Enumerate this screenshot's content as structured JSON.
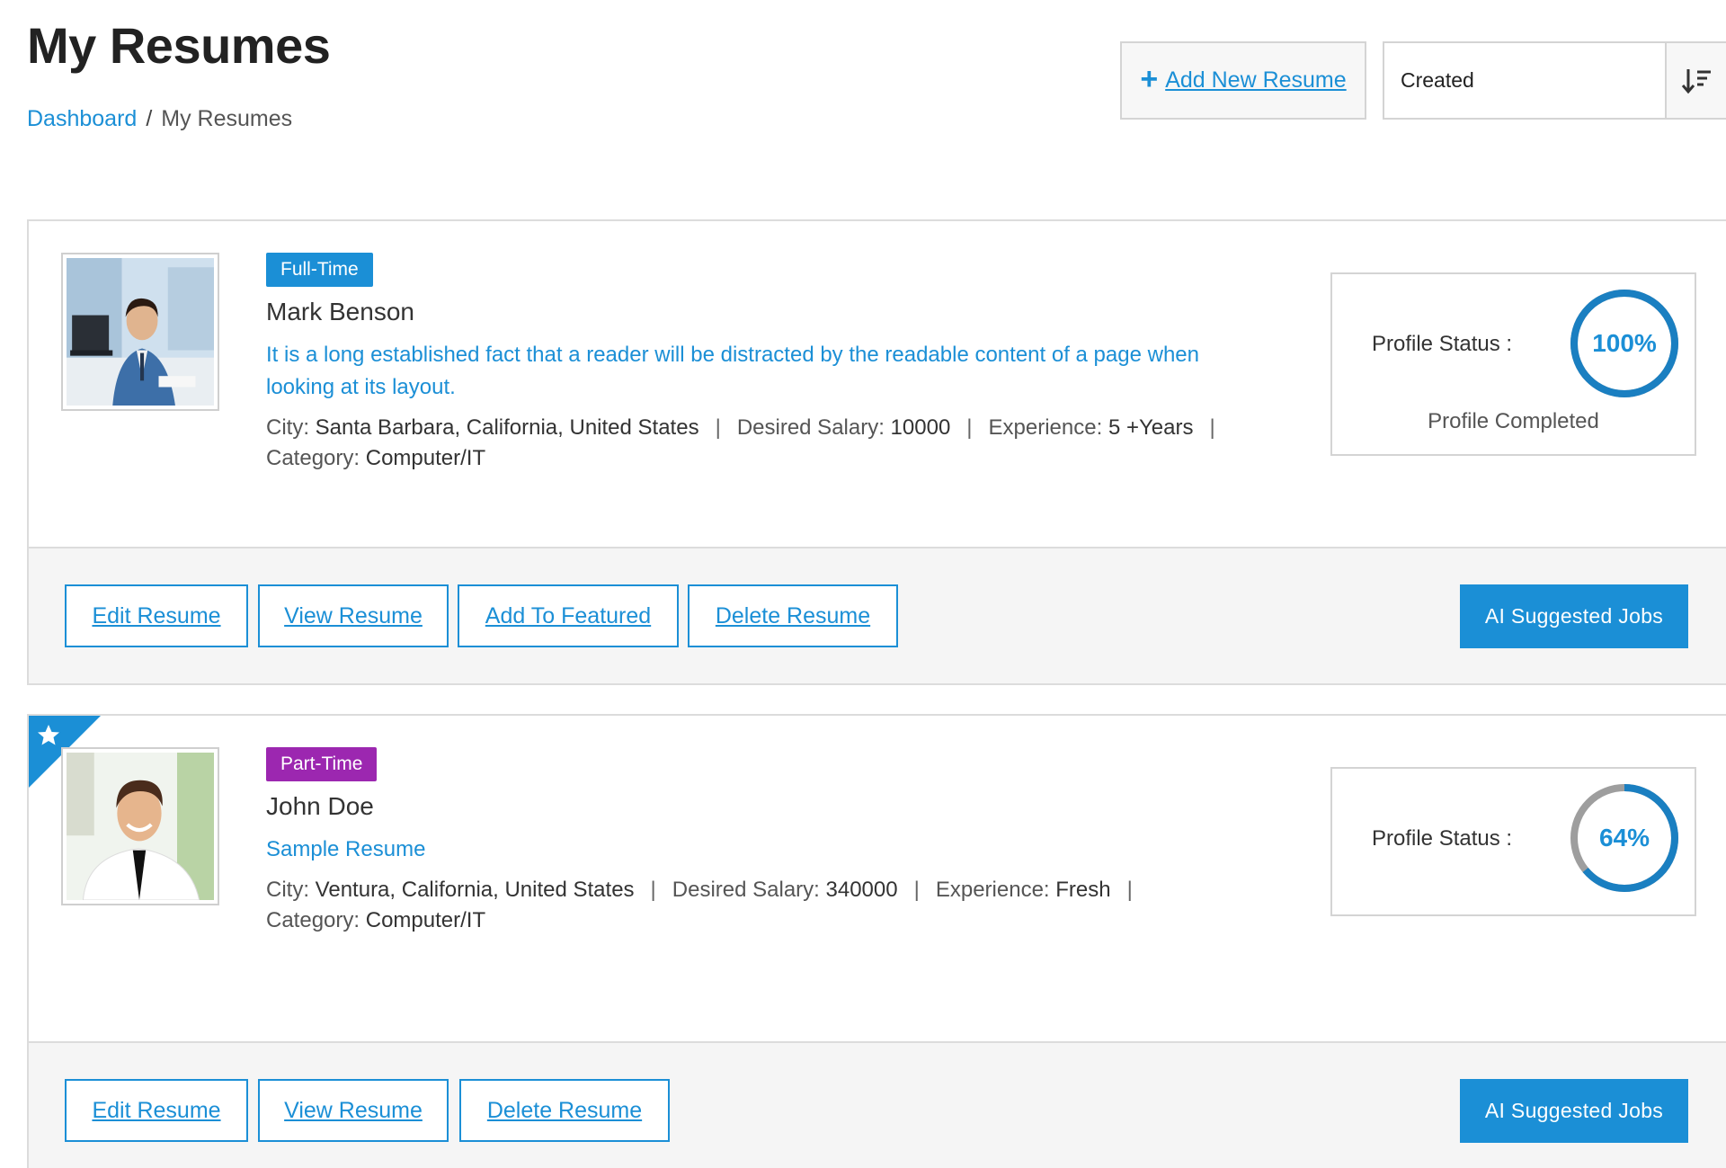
{
  "header": {
    "title": "My Resumes",
    "breadcrumb": {
      "home": "Dashboard",
      "separator": "/",
      "current": "My Resumes"
    },
    "add_button": {
      "icon": "plus-icon",
      "label": "Add New Resume"
    },
    "sort": {
      "selected": "Created",
      "icon": "sort-descending-icon"
    }
  },
  "colors": {
    "accent": "#1b8fd6",
    "full_time": "#1b8fd6",
    "part_time": "#9c27b0",
    "ring_track": "#9e9e9e"
  },
  "labels": {
    "city": "City:",
    "salary": "Desired Salary:",
    "experience": "Experience:",
    "category": "Category:",
    "profile_status": "Profile Status :",
    "ai_jobs": "AI Suggested Jobs",
    "edit": "Edit Resume",
    "view": "View Resume",
    "feature": "Add To Featured",
    "delete": "Delete Resume",
    "pipe": "|"
  },
  "resumes": [
    {
      "job_type": "Full-Time",
      "name": "Mark Benson",
      "description": "It is a long established fact that a reader will be distracted by the readable content of a page when looking at its layout.",
      "city": "Santa Barbara, California, United States",
      "salary": "10000",
      "experience": "5 +Years",
      "category": "Computer/IT",
      "profile_pct": "100%",
      "profile_fraction": 1.0,
      "profile_note": "Profile Completed",
      "featured": false
    },
    {
      "job_type": "Part-Time",
      "name": "John Doe",
      "description": "Sample Resume",
      "city": "Ventura, California, United States",
      "salary": "340000",
      "experience": "Fresh",
      "category": "Computer/IT",
      "profile_pct": "64%",
      "profile_fraction": 0.64,
      "featured": true,
      "featured_icon": "star-icon"
    }
  ]
}
